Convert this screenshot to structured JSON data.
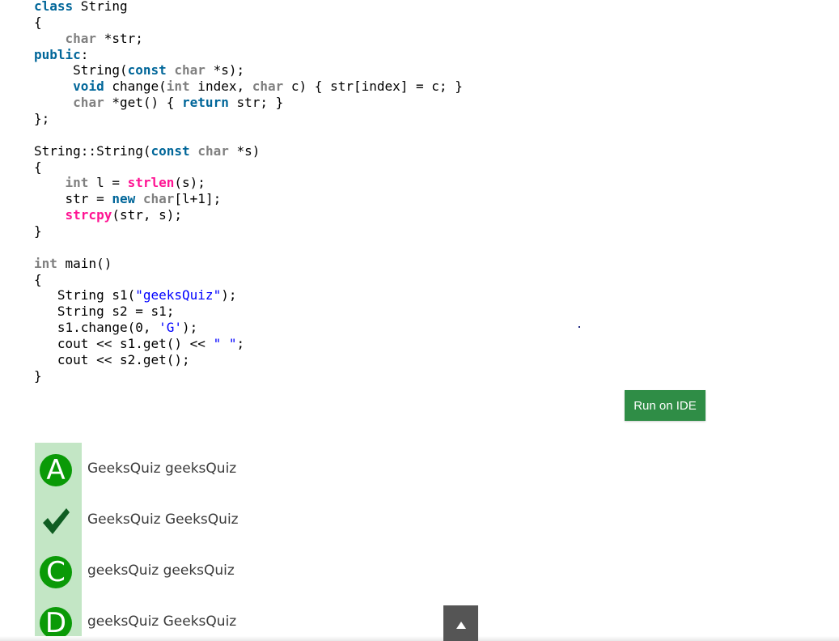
{
  "code": {
    "lines": [
      [
        {
          "t": "class",
          "c": "keyword"
        },
        {
          "t": " String",
          "c": "plain"
        }
      ],
      [
        {
          "t": "{",
          "c": "plain"
        }
      ],
      [
        {
          "t": "    ",
          "c": "plain"
        },
        {
          "t": "char",
          "c": "type"
        },
        {
          "t": " *str;",
          "c": "plain"
        }
      ],
      [
        {
          "t": "public",
          "c": "keyword"
        },
        {
          "t": ":",
          "c": "plain"
        }
      ],
      [
        {
          "t": "     String(",
          "c": "plain"
        },
        {
          "t": "const",
          "c": "keyword"
        },
        {
          "t": " ",
          "c": "plain"
        },
        {
          "t": "char",
          "c": "type"
        },
        {
          "t": " *s);",
          "c": "plain"
        }
      ],
      [
        {
          "t": "     ",
          "c": "plain"
        },
        {
          "t": "void",
          "c": "keyword"
        },
        {
          "t": " change(",
          "c": "plain"
        },
        {
          "t": "int",
          "c": "type"
        },
        {
          "t": " index, ",
          "c": "plain"
        },
        {
          "t": "char",
          "c": "type"
        },
        {
          "t": " c) { str[index] = c; }",
          "c": "plain"
        }
      ],
      [
        {
          "t": "     ",
          "c": "plain"
        },
        {
          "t": "char",
          "c": "type"
        },
        {
          "t": " *get() { ",
          "c": "plain"
        },
        {
          "t": "return",
          "c": "keyword"
        },
        {
          "t": " str; }",
          "c": "plain"
        }
      ],
      [
        {
          "t": "};",
          "c": "plain"
        }
      ],
      [],
      [
        {
          "t": "String::String(",
          "c": "plain"
        },
        {
          "t": "const",
          "c": "keyword"
        },
        {
          "t": " ",
          "c": "plain"
        },
        {
          "t": "char",
          "c": "type"
        },
        {
          "t": " *s)",
          "c": "plain"
        }
      ],
      [
        {
          "t": "{",
          "c": "plain"
        }
      ],
      [
        {
          "t": "    ",
          "c": "plain"
        },
        {
          "t": "int",
          "c": "type"
        },
        {
          "t": " l = ",
          "c": "plain"
        },
        {
          "t": "strlen",
          "c": "function"
        },
        {
          "t": "(s);",
          "c": "plain"
        }
      ],
      [
        {
          "t": "    str = ",
          "c": "plain"
        },
        {
          "t": "new",
          "c": "keyword"
        },
        {
          "t": " ",
          "c": "plain"
        },
        {
          "t": "char",
          "c": "type"
        },
        {
          "t": "[l+1];",
          "c": "plain"
        }
      ],
      [
        {
          "t": "    ",
          "c": "plain"
        },
        {
          "t": "strcpy",
          "c": "function"
        },
        {
          "t": "(str, s);",
          "c": "plain"
        }
      ],
      [
        {
          "t": "}",
          "c": "plain"
        }
      ],
      [],
      [
        {
          "t": "int",
          "c": "type"
        },
        {
          "t": " main()",
          "c": "plain"
        }
      ],
      [
        {
          "t": "{",
          "c": "plain"
        }
      ],
      [
        {
          "t": "   String s1(",
          "c": "plain"
        },
        {
          "t": "\"geeksQuiz\"",
          "c": "string"
        },
        {
          "t": ");",
          "c": "plain"
        }
      ],
      [
        {
          "t": "   String s2 = s1;",
          "c": "plain"
        }
      ],
      [
        {
          "t": "   s1.change(0, ",
          "c": "plain"
        },
        {
          "t": "'G'",
          "c": "string"
        },
        {
          "t": ");",
          "c": "plain"
        }
      ],
      [
        {
          "t": "   cout << s1.get() << ",
          "c": "plain"
        },
        {
          "t": "\" \"",
          "c": "string"
        },
        {
          "t": ";",
          "c": "plain"
        }
      ],
      [
        {
          "t": "   cout << s2.get();",
          "c": "plain"
        }
      ],
      [
        {
          "t": "}",
          "c": "plain"
        }
      ]
    ]
  },
  "run_button": {
    "label": "Run on IDE"
  },
  "options": [
    {
      "marker": "A",
      "icon": "option-a-badge",
      "text": "GeeksQuiz geeksQuiz",
      "correct": false
    },
    {
      "marker": "",
      "icon": "checkmark-icon",
      "text": "GeeksQuiz GeeksQuiz",
      "correct": true
    },
    {
      "marker": "C",
      "icon": "option-c-badge",
      "text": "geeksQuiz geeksQuiz",
      "correct": false
    },
    {
      "marker": "D",
      "icon": "option-d-badge",
      "text": "geeksQuiz GeeksQuiz",
      "correct": false
    }
  ],
  "scroll_top": {
    "icon": "arrow-up-icon"
  },
  "colors": {
    "keyword": "#006699",
    "type": "#808080",
    "function": "#ff1493",
    "string": "#0000ff",
    "run_button_bg": "#2f8d46",
    "option_strip": "#c3e6c5",
    "option_badge": "#0a9a07",
    "checkmark": "#0f5d22",
    "scroll_top_bg": "#555555"
  }
}
